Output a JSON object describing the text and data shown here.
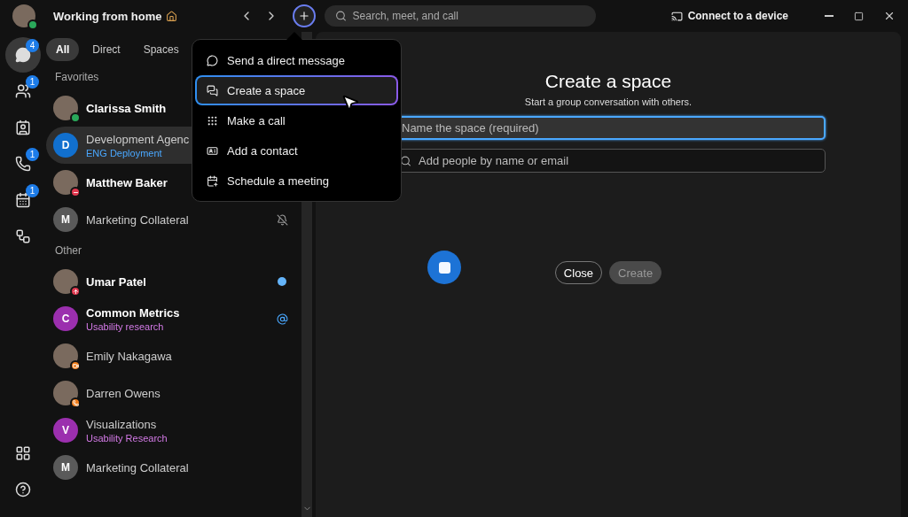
{
  "top_bar": {
    "status_text": "Working from home",
    "search": {
      "placeholder": "Search, meet, and call"
    },
    "connect_label": "Connect to a device"
  },
  "rail": {
    "items": [
      {
        "kind": "messaging",
        "badge": "4",
        "selected": true
      },
      {
        "kind": "teams",
        "badge": "1",
        "selected": false
      },
      {
        "kind": "contacts",
        "selected": false
      },
      {
        "kind": "calling",
        "badge": "1",
        "selected": false
      },
      {
        "kind": "meetings",
        "badge": "1",
        "selected": false
      },
      {
        "kind": "workflows",
        "selected": false
      }
    ],
    "bottom_items": [
      {
        "kind": "apps"
      },
      {
        "kind": "help"
      }
    ]
  },
  "filter_tabs": [
    {
      "label": "All",
      "selected": true
    },
    {
      "label": "Direct",
      "selected": false
    },
    {
      "label": "Spaces",
      "selected": false
    }
  ],
  "sections": [
    {
      "title": "Favorites",
      "items": [
        {
          "kind": "person",
          "name": "Clarissa Smith",
          "unread": true,
          "presence": {
            "kind": "active"
          },
          "selected": false
        },
        {
          "kind": "space",
          "initial": "D",
          "color": "#1170cf",
          "name": "Development Agenc",
          "subtitle": {
            "text": "ENG Deployment",
            "color": "#4aa8ff"
          },
          "unread": false,
          "selected": true
        },
        {
          "kind": "person",
          "name": "Matthew Baker",
          "unread": true,
          "presence": {
            "kind": "dnd"
          },
          "selected": false
        },
        {
          "kind": "space",
          "initial": "M",
          "color": "#5a5a5a",
          "name": "Marketing Collateral",
          "unread": false,
          "indicator": {
            "kind": "muted"
          },
          "selected": false
        }
      ]
    },
    {
      "title": "Other",
      "items": [
        {
          "kind": "person",
          "name": "Umar Patel",
          "unread": true,
          "presence": {
            "kind": "presenting"
          },
          "indicator": {
            "kind": "unread"
          },
          "selected": false
        },
        {
          "kind": "space",
          "initial": "C",
          "color": "#9b2fae",
          "name": "Common Metrics",
          "subtitle": {
            "text": "Usability research",
            "color": "#d57be8"
          },
          "unread": true,
          "indicator": {
            "kind": "mention"
          },
          "selected": false
        },
        {
          "kind": "person",
          "name": "Emily Nakagawa",
          "unread": false,
          "presence": {
            "kind": "meeting"
          },
          "selected": false
        },
        {
          "kind": "person",
          "name": "Darren Owens",
          "unread": false,
          "presence": {
            "kind": "call"
          },
          "selected": false
        },
        {
          "kind": "space",
          "initial": "V",
          "color": "#9b2fae",
          "name": "Visualizations",
          "subtitle": {
            "text": "Usability Research",
            "color": "#d57be8"
          },
          "unread": false,
          "selected": false
        },
        {
          "kind": "space",
          "initial": "M",
          "color": "#5a5a5a",
          "name": "Marketing Collateral",
          "unread": false,
          "selected": false
        }
      ]
    }
  ],
  "new_menu": {
    "items": [
      {
        "kind": "message",
        "label": "Send a direct message",
        "selected": false
      },
      {
        "kind": "space",
        "label": "Create a space",
        "selected": true
      },
      {
        "kind": "call",
        "label": "Make a call",
        "selected": false
      },
      {
        "kind": "contact",
        "label": "Add a contact",
        "selected": false
      },
      {
        "kind": "meeting",
        "label": "Schedule a meeting",
        "selected": false
      }
    ]
  },
  "create_space": {
    "title": "Create a space",
    "subtitle": "Start a group conversation with others.",
    "name_field": {
      "placeholder": "Name the space (required)"
    },
    "people_field": {
      "placeholder": "Add people by name or email"
    },
    "buttons": [
      {
        "label": "Close",
        "disabled": false
      },
      {
        "label": "Create",
        "disabled": true
      }
    ]
  }
}
